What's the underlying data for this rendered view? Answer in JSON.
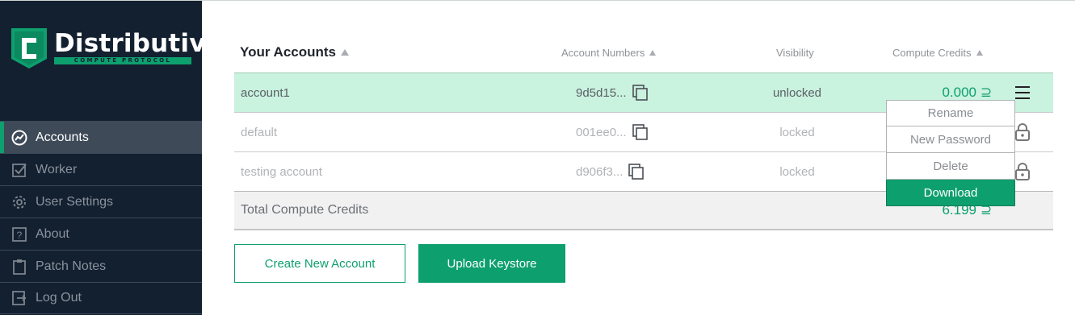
{
  "brand": {
    "name": "Distributive",
    "tagline": "COMPUTE PROTOCOL",
    "logo_letter": "C"
  },
  "sidebar": {
    "items": [
      {
        "label": "Accounts",
        "icon": "chart-line-icon",
        "active": true
      },
      {
        "label": "Worker",
        "icon": "checkbox-icon",
        "active": false
      },
      {
        "label": "User Settings",
        "icon": "gear-icon",
        "active": false
      },
      {
        "label": "About",
        "icon": "question-icon",
        "active": false
      },
      {
        "label": "Patch Notes",
        "icon": "clipboard-icon",
        "active": false
      },
      {
        "label": "Log Out",
        "icon": "logout-icon",
        "active": false
      }
    ]
  },
  "table": {
    "columns": {
      "accounts": "Your Accounts",
      "numbers": "Account Numbers",
      "visibility": "Visibility",
      "credits": "Compute Credits"
    },
    "rows": [
      {
        "name": "account1",
        "number": "9d5d15...",
        "visibility": "unlocked",
        "credits": "0.000",
        "credits_symbol": "⊇",
        "selected": true
      },
      {
        "name": "default",
        "number": "001ee0...",
        "visibility": "locked",
        "credits": "",
        "selected": false
      },
      {
        "name": "testing account",
        "number": "d906f3...",
        "visibility": "locked",
        "credits": "",
        "selected": false
      }
    ],
    "total": {
      "label": "Total Compute Credits",
      "value": "6.199",
      "symbol": "⊇"
    }
  },
  "buttons": {
    "create": "Create New Account",
    "upload": "Upload Keystore"
  },
  "dropdown": {
    "items": [
      "Rename",
      "New Password",
      "Delete",
      "Download"
    ]
  },
  "colors": {
    "sidebar_bg": "#132030",
    "accent": "#0e9f6e",
    "selected_row": "#c9f2df"
  }
}
